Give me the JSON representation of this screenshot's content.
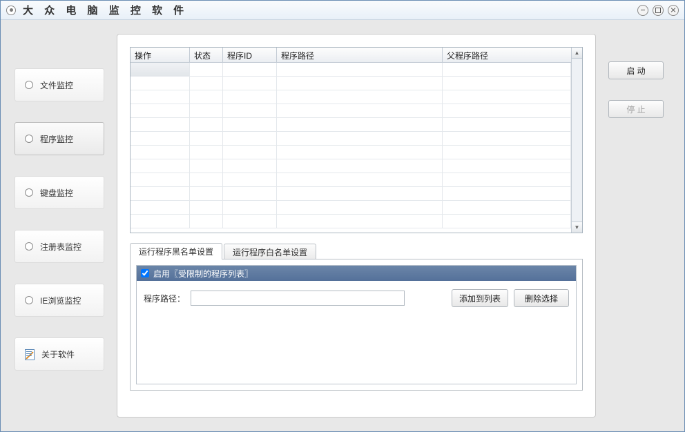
{
  "window": {
    "title": "大 众 电 脑 监 控 软 件"
  },
  "sidebar": {
    "items": [
      {
        "label": "文件监控",
        "kind": "radio"
      },
      {
        "label": "程序监控",
        "kind": "radio",
        "active": true
      },
      {
        "label": "键盘监控",
        "kind": "radio"
      },
      {
        "label": "注册表监控",
        "kind": "radio"
      },
      {
        "label": "IE浏览监控",
        "kind": "radio"
      },
      {
        "label": "关于软件",
        "kind": "about"
      }
    ]
  },
  "actions": {
    "start": "启 动",
    "stop": "停 止"
  },
  "table": {
    "columns": [
      "操作",
      "状态",
      "程序ID",
      "程序路径",
      "父程序路径"
    ],
    "rows": []
  },
  "tabs": {
    "items": [
      {
        "label": "运行程序黑名单设置",
        "active": true
      },
      {
        "label": "运行程序白名单设置",
        "active": false
      }
    ]
  },
  "blacklist": {
    "enable_label": "启用〖受限制的程序列表〗",
    "enable_checked": true,
    "path_label": "程序路径：",
    "path_value": "",
    "add_btn": "添加到列表",
    "remove_btn": "删除选择"
  }
}
